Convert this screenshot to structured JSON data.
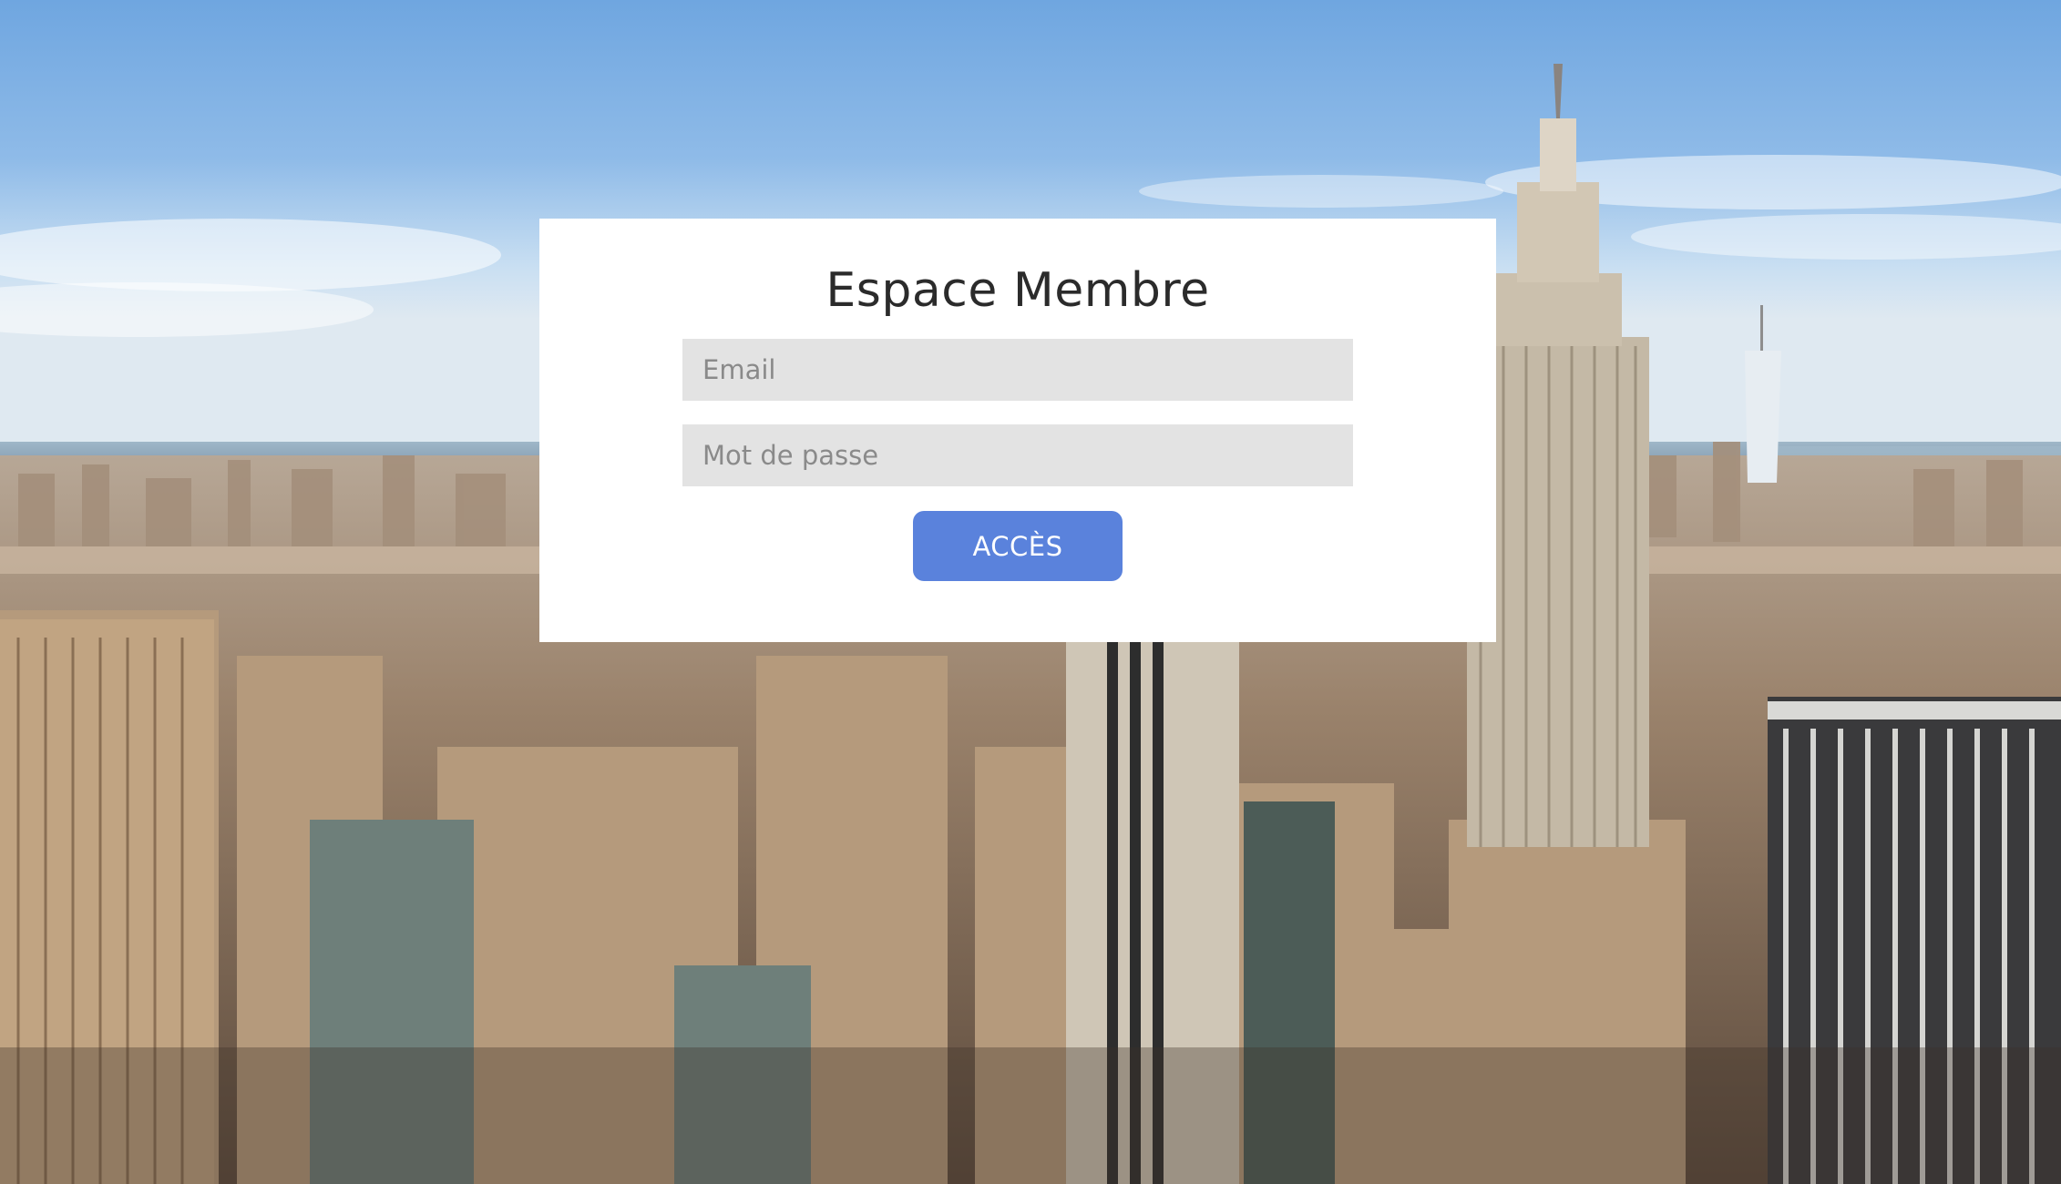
{
  "login": {
    "title": "Espace Membre",
    "email": {
      "placeholder": "Email",
      "value": ""
    },
    "password": {
      "placeholder": "Mot de passe",
      "value": ""
    },
    "submit_label": "ACCÈS"
  },
  "colors": {
    "card_background": "#ffffff",
    "field_background": "#e3e3e3",
    "button_background": "#5a82dc",
    "button_text": "#ffffff",
    "title_text": "#2b2b2b"
  }
}
